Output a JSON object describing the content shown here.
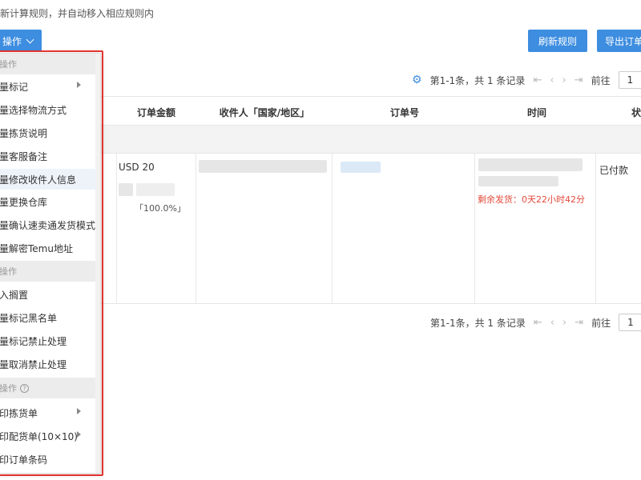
{
  "notice": "新计算规则，并自动移入相应规则内",
  "toolbar": {
    "ops_label": "操作",
    "refresh_label": "刷新规则",
    "export_label": "导出订单"
  },
  "pager_top": {
    "summary": "第1-1条，共 1 条记录",
    "goto_label": "前往",
    "page_value": "1"
  },
  "pager_bottom": {
    "summary": "第1-1条，共 1 条记录",
    "goto_label": "前往",
    "page_value": "1"
  },
  "table": {
    "headers": [
      "订单金额",
      "收件人「国家/地区」",
      "订单号",
      "时间",
      "状态"
    ],
    "row": {
      "amount": "USD 20",
      "percent": "「100.0%」",
      "remaining": "剩余发货：0天22小时42分",
      "status": "已付款"
    }
  },
  "dropdown": {
    "group1": "操作",
    "group1_items": [
      "量标记",
      "量选择物流方式",
      "量拣货说明",
      "量客服备注",
      "量修改收件人信息",
      "量更换仓库",
      "量确认速卖通发货模式",
      "量解密Temu地址"
    ],
    "group2": "操作",
    "group2_items": [
      "入搁置",
      "量标记黑名单",
      "量标记禁止处理",
      "量取消禁止处理"
    ],
    "group3": "操作",
    "group3_items": [
      "印拣货单",
      "印配货单(10×10)",
      "印订单条码"
    ]
  },
  "colors": {
    "accent": "#3d8de0",
    "highlight_frame": "#e2342e",
    "warning_text": "#e24a3b"
  },
  "icons": [
    "chevron-down-icon",
    "gear-icon",
    "first-page-icon",
    "prev-page-icon",
    "next-page-icon",
    "last-page-icon",
    "submenu-arrow-icon",
    "help-circle-icon"
  ]
}
